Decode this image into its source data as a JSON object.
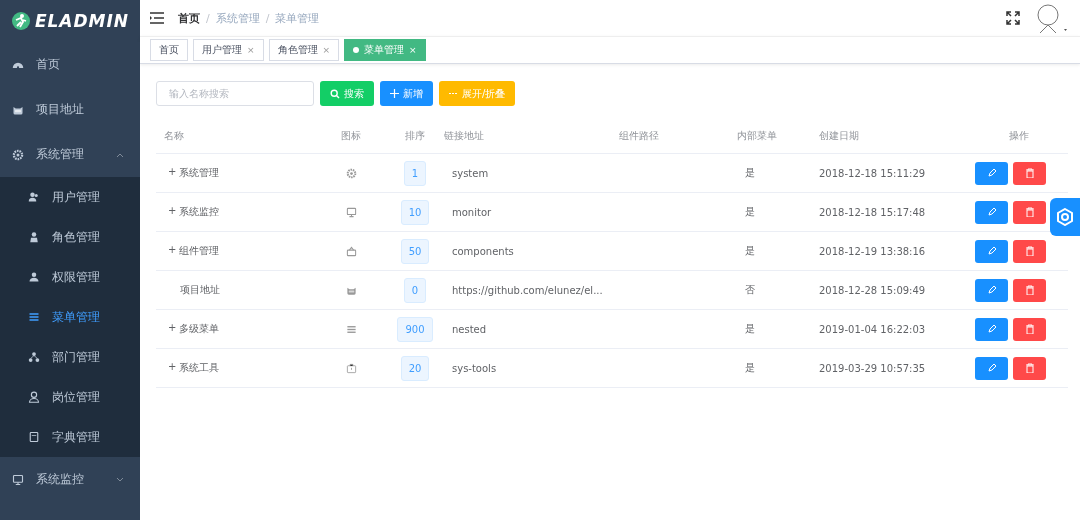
{
  "logo": {
    "text": "ELADMIN"
  },
  "sidebar": {
    "items": [
      {
        "label": "首页",
        "kind": "dashboard",
        "selected": false
      },
      {
        "label": "项目地址",
        "kind": "github",
        "selected": false
      },
      {
        "label": "系统管理",
        "kind": "gear",
        "selected": false,
        "expanded": true,
        "children": [
          {
            "label": "用户管理",
            "kind": "users",
            "selected": false
          },
          {
            "label": "角色管理",
            "kind": "role",
            "selected": false
          },
          {
            "label": "权限管理",
            "kind": "permission",
            "selected": false
          },
          {
            "label": "菜单管理",
            "kind": "list",
            "selected": true
          },
          {
            "label": "部门管理",
            "kind": "dept",
            "selected": false
          },
          {
            "label": "岗位管理",
            "kind": "post",
            "selected": false
          },
          {
            "label": "字典管理",
            "kind": "dict",
            "selected": false
          }
        ]
      },
      {
        "label": "系统监控",
        "kind": "monitor",
        "selected": false,
        "expanded": false
      }
    ]
  },
  "breadcrumb": [
    {
      "label": "首页"
    },
    {
      "separator": "/",
      "label": "系统管理"
    },
    {
      "separator": "/",
      "label": "菜单管理"
    }
  ],
  "tabs": [
    {
      "label": "首页",
      "selected": false
    },
    {
      "label": "用户管理",
      "selected": false,
      "close": "×"
    },
    {
      "label": "角色管理",
      "selected": false,
      "close": "×"
    },
    {
      "label": "菜单管理",
      "selected": true,
      "close": "×"
    }
  ],
  "toolbar": {
    "search": {
      "placeholder": "输入名称搜索"
    },
    "buttons": [
      {
        "label": "搜索",
        "kind": "search"
      },
      {
        "label": "新增",
        "kind": "add"
      },
      {
        "label": "展开/折叠",
        "kind": "toggle"
      }
    ]
  },
  "table": {
    "columns": [
      "名称",
      "图标",
      "排序",
      "链接地址",
      "组件路径",
      "内部菜单",
      "创建日期",
      "操作"
    ],
    "rows": [
      {
        "expander": "+",
        "name": "系统管理",
        "kind": "gear",
        "sort": "1",
        "link": "system",
        "internal": "是",
        "created": "2018-12-18 15:11:29"
      },
      {
        "expander": "+",
        "name": "系统监控",
        "kind": "monitor",
        "sort": "10",
        "link": "monitor",
        "internal": "是",
        "created": "2018-12-18 15:17:48"
      },
      {
        "expander": "+",
        "name": "组件管理",
        "kind": "component",
        "sort": "50",
        "link": "components",
        "internal": "是",
        "created": "2018-12-19 13:38:16"
      },
      {
        "name": "项目地址",
        "kind": "github",
        "sort": "0",
        "link": "https://github.com/elunez/el...",
        "internal": "否",
        "created": "2018-12-28 15:09:49"
      },
      {
        "expander": "+",
        "name": "多级菜单",
        "kind": "list",
        "sort": "900",
        "link": "nested",
        "internal": "是",
        "created": "2019-01-04 16:22:03"
      },
      {
        "expander": "+",
        "name": "系统工具",
        "kind": "tools",
        "sort": "20",
        "link": "sys-tools",
        "internal": "是",
        "created": "2019-03-29 10:57:35"
      }
    ]
  }
}
